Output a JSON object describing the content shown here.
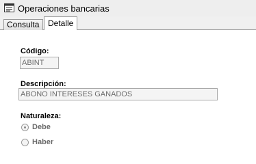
{
  "window": {
    "title": "Operaciones bancarias",
    "icon": "form-window-icon"
  },
  "tabs": [
    {
      "label": "Consulta",
      "active": false
    },
    {
      "label": "Detalle",
      "active": true
    }
  ],
  "form": {
    "codigo": {
      "label": "Código:",
      "value": "ABINT"
    },
    "descripcion": {
      "label": "Descripción:",
      "value": "ABONO INTERESES GANADOS"
    },
    "naturaleza": {
      "label": "Naturaleza:",
      "options": [
        {
          "label": "Debe",
          "selected": true
        },
        {
          "label": "Haber",
          "selected": false
        }
      ]
    }
  }
}
